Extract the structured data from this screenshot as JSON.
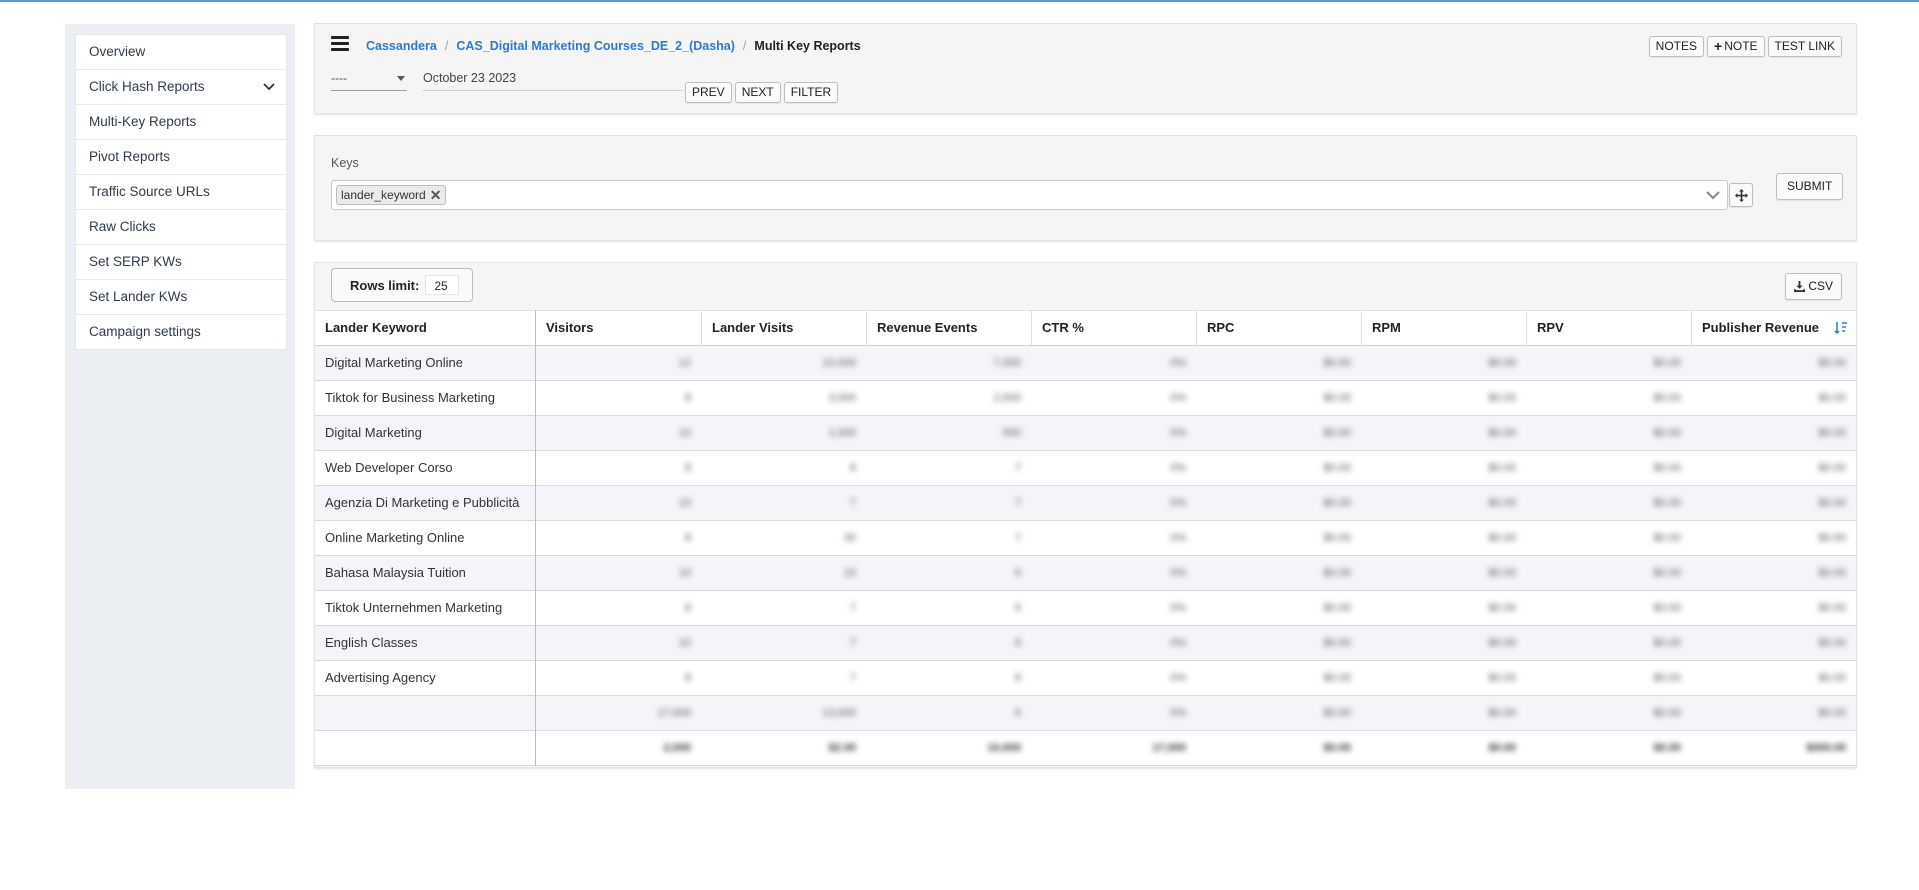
{
  "sidebar": {
    "items": [
      {
        "label": "Overview"
      },
      {
        "label": "Click Hash Reports",
        "expandable": true
      },
      {
        "label": "Multi-Key Reports"
      },
      {
        "label": "Pivot Reports"
      },
      {
        "label": "Traffic Source URLs"
      },
      {
        "label": "Raw Clicks"
      },
      {
        "label": "Set SERP KWs"
      },
      {
        "label": "Set Lander KWs"
      },
      {
        "label": "Campaign settings"
      }
    ]
  },
  "header": {
    "breadcrumb": [
      "Cassandera",
      "CAS_Digital Marketing Courses_DE_2_(Dasha)"
    ],
    "current_page": "Multi Key Reports",
    "buttons": {
      "notes": "NOTES",
      "note": "NOTE",
      "test_link": "TEST LINK"
    },
    "range_select": "----",
    "date": "October 23 2023",
    "nav": {
      "prev": "PREV",
      "next": "NEXT",
      "filter": "FILTER"
    }
  },
  "keys": {
    "label": "Keys",
    "selected": [
      "lander_keyword"
    ],
    "submit": "SUBMIT"
  },
  "table": {
    "rows_limit_label": "Rows limit:",
    "rows_limit_value": "25",
    "csv_label": "CSV",
    "key_header": "Lander Keyword",
    "columns": [
      "Visitors",
      "Lander Visits",
      "Revenue Events",
      "CTR %",
      "RPC",
      "RPM",
      "RPV",
      "Publisher Revenue"
    ],
    "rows": [
      {
        "keyword": "Digital Marketing Online",
        "cells": [
          "12",
          "10,000",
          "7,000",
          "0%",
          "$0.00",
          "$0.00",
          "$0.00",
          "$0.00"
        ]
      },
      {
        "keyword": "Tiktok for Business Marketing",
        "cells": [
          "8",
          "3,000",
          "2,000",
          "0%",
          "$0.00",
          "$0.00",
          "$0.00",
          "$0.00"
        ]
      },
      {
        "keyword": "Digital Marketing",
        "cells": [
          "10",
          "1,000",
          "900",
          "0%",
          "$0.00",
          "$0.00",
          "$0.00",
          "$0.00"
        ]
      },
      {
        "keyword": "Web Developer Corso",
        "cells": [
          "8",
          "8",
          "7",
          "0%",
          "$0.00",
          "$0.00",
          "$0.00",
          "$0.00"
        ]
      },
      {
        "keyword": "Agenzia Di Marketing e Pubblicità",
        "cells": [
          "10",
          "7",
          "7",
          "0%",
          "$0.00",
          "$0.00",
          "$0.00",
          "$0.00"
        ]
      },
      {
        "keyword": "Online Marketing Online",
        "cells": [
          "8",
          "30",
          "7",
          "0%",
          "$0.00",
          "$0.00",
          "$0.00",
          "$0.00"
        ]
      },
      {
        "keyword": "Bahasa Malaysia Tuition",
        "cells": [
          "10",
          "10",
          "6",
          "0%",
          "$0.00",
          "$0.00",
          "$0.00",
          "$0.00"
        ]
      },
      {
        "keyword": "Tiktok Unternehmen Marketing",
        "cells": [
          "8",
          "7",
          "6",
          "0%",
          "$0.00",
          "$0.00",
          "$0.00",
          "$0.00"
        ]
      },
      {
        "keyword": "English Classes",
        "cells": [
          "10",
          "7",
          "6",
          "0%",
          "$0.00",
          "$0.00",
          "$0.00",
          "$0.00"
        ]
      },
      {
        "keyword": "Advertising Agency",
        "cells": [
          "8",
          "7",
          "6",
          "0%",
          "$0.00",
          "$0.00",
          "$0.00",
          "$0.00"
        ]
      },
      {
        "keyword": "",
        "cells": [
          "17,000",
          "13,000",
          "6",
          "0%",
          "$0.00",
          "$0.00",
          "$0.00",
          "$0.00"
        ]
      }
    ],
    "total": {
      "keyword": "",
      "cells": [
        "2,000",
        "$2.00",
        "10,000",
        "17,000",
        "$0.00",
        "$0.00",
        "$0.00",
        "$000.00"
      ]
    }
  },
  "colors": {
    "accent": "#2b7bd4",
    "card_bg": "#f5f5f5",
    "sidebar_bg": "#ebeef2",
    "top_line": "#5b9bd5"
  }
}
